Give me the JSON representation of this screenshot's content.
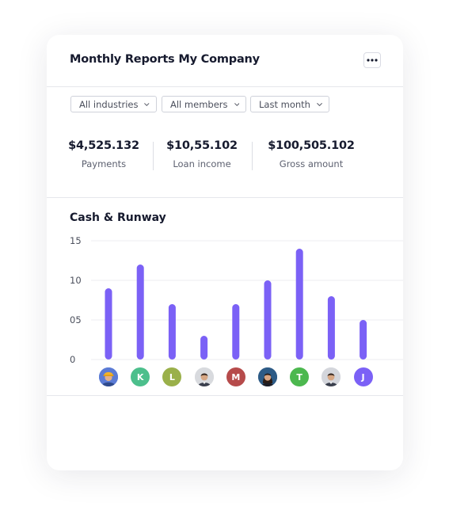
{
  "header": {
    "title": "Monthly Reports My Company",
    "menu_icon": "more-horizontal-icon"
  },
  "filters": [
    {
      "label": "All industries",
      "icon": "chevron-down-icon"
    },
    {
      "label": "All members",
      "icon": "chevron-down-icon"
    },
    {
      "label": "Last month",
      "icon": "chevron-down-icon"
    }
  ],
  "stats": [
    {
      "value": "$4,525.132",
      "label": "Payments"
    },
    {
      "value": "$10,55.102",
      "label": "Loan income"
    },
    {
      "value": "$100,505.102",
      "label": "Gross amount"
    }
  ],
  "chart_data": {
    "type": "bar",
    "title": "Cash & Runway",
    "xlabel": "",
    "ylabel": "",
    "ylim": [
      0,
      15
    ],
    "yticks": [
      "15",
      "10",
      "05",
      "0"
    ],
    "ytick_values": [
      15,
      10,
      5,
      0
    ],
    "grid": true,
    "bar_color": "#7b61f6",
    "values": [
      9,
      12,
      7,
      3,
      7,
      10,
      14,
      8,
      5
    ],
    "categories": [
      {
        "kind": "photo",
        "letter": "",
        "color": "#5b7bd5",
        "icon": "avatar-worker-icon"
      },
      {
        "kind": "letter",
        "letter": "K",
        "color": "#4cbf8c",
        "icon": ""
      },
      {
        "kind": "letter",
        "letter": "L",
        "color": "#9ab04a",
        "icon": ""
      },
      {
        "kind": "photo",
        "letter": "",
        "color": "#d8dade",
        "icon": "avatar-man-icon"
      },
      {
        "kind": "letter",
        "letter": "M",
        "color": "#b64b4b",
        "icon": ""
      },
      {
        "kind": "photo",
        "letter": "",
        "color": "#2d5b86",
        "icon": "avatar-woman-icon"
      },
      {
        "kind": "letter",
        "letter": "T",
        "color": "#4cb84f",
        "icon": ""
      },
      {
        "kind": "photo",
        "letter": "",
        "color": "#d4d6dc",
        "icon": "avatar-man-icon"
      },
      {
        "kind": "letter",
        "letter": "J",
        "color": "#7b61f6",
        "icon": ""
      }
    ]
  }
}
